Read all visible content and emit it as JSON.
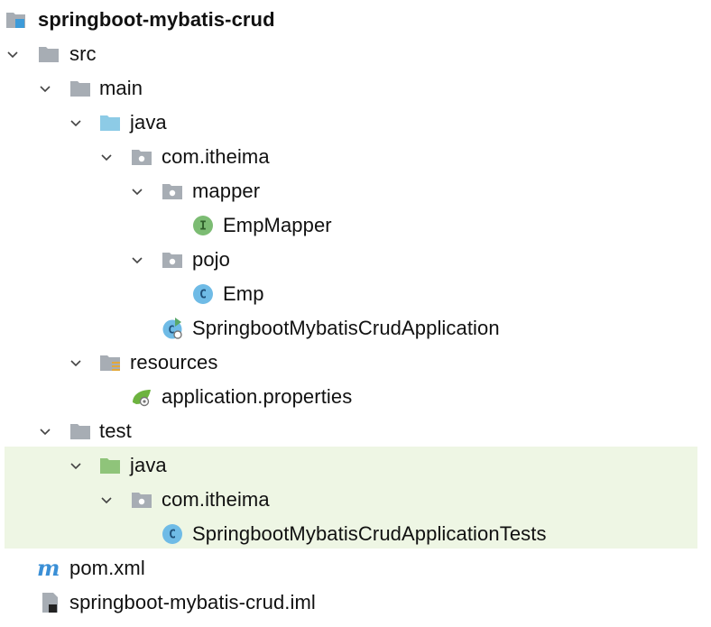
{
  "colors": {
    "folder_gray": "#a7adb4",
    "folder_blue": "#8dcbe6",
    "folder_green": "#8fc47a",
    "interface_green": "#7cbc73",
    "class_blue": "#4fa7da",
    "maven_blue": "#3a8fd6",
    "highlight": "#eef6e4"
  },
  "tree": {
    "root": "springboot-mybatis-crud",
    "src": "src",
    "main": "main",
    "main_java": "java",
    "main_pkg": "com.itheima",
    "mapper_pkg": "mapper",
    "emp_mapper": "EmpMapper",
    "pojo_pkg": "pojo",
    "emp": "Emp",
    "app_class": "SpringbootMybatisCrudApplication",
    "resources": "resources",
    "app_props": "application.properties",
    "test": "test",
    "test_java": "java",
    "test_pkg": "com.itheima",
    "test_class": "SpringbootMybatisCrudApplicationTests",
    "pom": "pom.xml",
    "iml": "springboot-mybatis-crud.iml"
  },
  "icons": {
    "root": "module-folder-icon",
    "folder": "folder-icon",
    "source_root": "source-root-folder-icon",
    "package": "package-icon",
    "interface": "interface-icon",
    "class": "class-icon",
    "spring_boot_class": "spring-boot-class-icon",
    "resources_root": "resources-root-folder-icon",
    "spring_properties": "spring-properties-icon",
    "test_root": "test-root-folder-icon",
    "maven": "maven-icon",
    "iml": "iml-file-icon"
  }
}
